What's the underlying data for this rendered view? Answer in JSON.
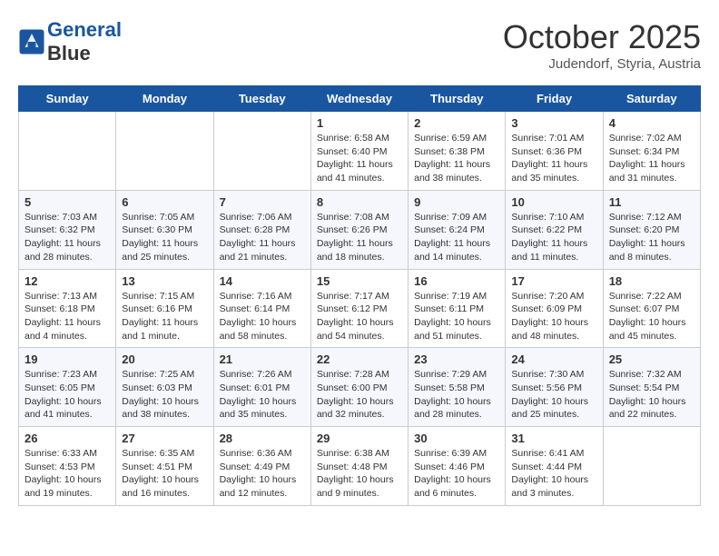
{
  "header": {
    "logo_line1": "General",
    "logo_line2": "Blue",
    "month": "October 2025",
    "location": "Judendorf, Styria, Austria"
  },
  "weekdays": [
    "Sunday",
    "Monday",
    "Tuesday",
    "Wednesday",
    "Thursday",
    "Friday",
    "Saturday"
  ],
  "weeks": [
    [
      {
        "day": "",
        "info": ""
      },
      {
        "day": "",
        "info": ""
      },
      {
        "day": "",
        "info": ""
      },
      {
        "day": "1",
        "info": "Sunrise: 6:58 AM\nSunset: 6:40 PM\nDaylight: 11 hours and 41 minutes."
      },
      {
        "day": "2",
        "info": "Sunrise: 6:59 AM\nSunset: 6:38 PM\nDaylight: 11 hours and 38 minutes."
      },
      {
        "day": "3",
        "info": "Sunrise: 7:01 AM\nSunset: 6:36 PM\nDaylight: 11 hours and 35 minutes."
      },
      {
        "day": "4",
        "info": "Sunrise: 7:02 AM\nSunset: 6:34 PM\nDaylight: 11 hours and 31 minutes."
      }
    ],
    [
      {
        "day": "5",
        "info": "Sunrise: 7:03 AM\nSunset: 6:32 PM\nDaylight: 11 hours and 28 minutes."
      },
      {
        "day": "6",
        "info": "Sunrise: 7:05 AM\nSunset: 6:30 PM\nDaylight: 11 hours and 25 minutes."
      },
      {
        "day": "7",
        "info": "Sunrise: 7:06 AM\nSunset: 6:28 PM\nDaylight: 11 hours and 21 minutes."
      },
      {
        "day": "8",
        "info": "Sunrise: 7:08 AM\nSunset: 6:26 PM\nDaylight: 11 hours and 18 minutes."
      },
      {
        "day": "9",
        "info": "Sunrise: 7:09 AM\nSunset: 6:24 PM\nDaylight: 11 hours and 14 minutes."
      },
      {
        "day": "10",
        "info": "Sunrise: 7:10 AM\nSunset: 6:22 PM\nDaylight: 11 hours and 11 minutes."
      },
      {
        "day": "11",
        "info": "Sunrise: 7:12 AM\nSunset: 6:20 PM\nDaylight: 11 hours and 8 minutes."
      }
    ],
    [
      {
        "day": "12",
        "info": "Sunrise: 7:13 AM\nSunset: 6:18 PM\nDaylight: 11 hours and 4 minutes."
      },
      {
        "day": "13",
        "info": "Sunrise: 7:15 AM\nSunset: 6:16 PM\nDaylight: 11 hours and 1 minute."
      },
      {
        "day": "14",
        "info": "Sunrise: 7:16 AM\nSunset: 6:14 PM\nDaylight: 10 hours and 58 minutes."
      },
      {
        "day": "15",
        "info": "Sunrise: 7:17 AM\nSunset: 6:12 PM\nDaylight: 10 hours and 54 minutes."
      },
      {
        "day": "16",
        "info": "Sunrise: 7:19 AM\nSunset: 6:11 PM\nDaylight: 10 hours and 51 minutes."
      },
      {
        "day": "17",
        "info": "Sunrise: 7:20 AM\nSunset: 6:09 PM\nDaylight: 10 hours and 48 minutes."
      },
      {
        "day": "18",
        "info": "Sunrise: 7:22 AM\nSunset: 6:07 PM\nDaylight: 10 hours and 45 minutes."
      }
    ],
    [
      {
        "day": "19",
        "info": "Sunrise: 7:23 AM\nSunset: 6:05 PM\nDaylight: 10 hours and 41 minutes."
      },
      {
        "day": "20",
        "info": "Sunrise: 7:25 AM\nSunset: 6:03 PM\nDaylight: 10 hours and 38 minutes."
      },
      {
        "day": "21",
        "info": "Sunrise: 7:26 AM\nSunset: 6:01 PM\nDaylight: 10 hours and 35 minutes."
      },
      {
        "day": "22",
        "info": "Sunrise: 7:28 AM\nSunset: 6:00 PM\nDaylight: 10 hours and 32 minutes."
      },
      {
        "day": "23",
        "info": "Sunrise: 7:29 AM\nSunset: 5:58 PM\nDaylight: 10 hours and 28 minutes."
      },
      {
        "day": "24",
        "info": "Sunrise: 7:30 AM\nSunset: 5:56 PM\nDaylight: 10 hours and 25 minutes."
      },
      {
        "day": "25",
        "info": "Sunrise: 7:32 AM\nSunset: 5:54 PM\nDaylight: 10 hours and 22 minutes."
      }
    ],
    [
      {
        "day": "26",
        "info": "Sunrise: 6:33 AM\nSunset: 4:53 PM\nDaylight: 10 hours and 19 minutes."
      },
      {
        "day": "27",
        "info": "Sunrise: 6:35 AM\nSunset: 4:51 PM\nDaylight: 10 hours and 16 minutes."
      },
      {
        "day": "28",
        "info": "Sunrise: 6:36 AM\nSunset: 4:49 PM\nDaylight: 10 hours and 12 minutes."
      },
      {
        "day": "29",
        "info": "Sunrise: 6:38 AM\nSunset: 4:48 PM\nDaylight: 10 hours and 9 minutes."
      },
      {
        "day": "30",
        "info": "Sunrise: 6:39 AM\nSunset: 4:46 PM\nDaylight: 10 hours and 6 minutes."
      },
      {
        "day": "31",
        "info": "Sunrise: 6:41 AM\nSunset: 4:44 PM\nDaylight: 10 hours and 3 minutes."
      },
      {
        "day": "",
        "info": ""
      }
    ]
  ]
}
